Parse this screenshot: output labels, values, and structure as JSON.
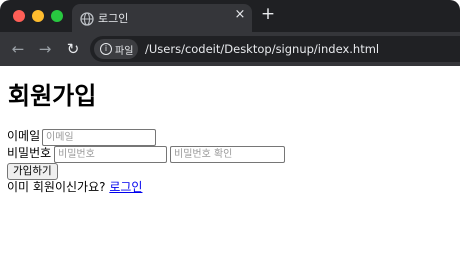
{
  "browser": {
    "tab_title": "로그인",
    "tab_close": "×",
    "new_tab": "+",
    "nav_back": "←",
    "nav_forward": "→",
    "nav_reload": "↻",
    "site_info_label": "파일",
    "site_info_icon": "i",
    "url": "/Users/codeit/Desktop/signup/index.html",
    "colors": {
      "tabbar_bg": "#1f2023",
      "toolbar_bg": "#35363a",
      "traffic_red": "#ff5f57",
      "traffic_yellow": "#febc2e",
      "traffic_green": "#28c840"
    }
  },
  "page": {
    "heading": "회원가입",
    "email_label": "이메일",
    "email_placeholder": "이메일",
    "password_label": "비밀번호",
    "password_placeholder": "비밀번호",
    "password_confirm_placeholder": "비밀번호 확인",
    "signup_button": "가입하기",
    "login_prompt": "이미 회원이신가요?",
    "login_link": "로그인",
    "link_color": "#0000ee"
  }
}
